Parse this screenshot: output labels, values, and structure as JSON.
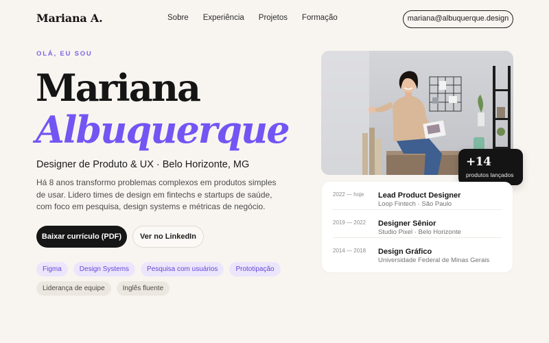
{
  "nav": {
    "logo": "Mariana A.",
    "links": [
      "Sobre",
      "Experiência",
      "Projetos",
      "Formação"
    ],
    "email": "mariana@albuquerque.design"
  },
  "hero": {
    "kicker": "OLÁ, EU SOU",
    "first_name": "Mariana",
    "last_name": "Albuquerque",
    "subtitle": "Designer de Produto & UX · Belo Horizonte, MG",
    "bio": "Há 8 anos transformo problemas complexos em produtos simples de usar. Lidero times de design em fintechs e startups de saúde, com foco em pesquisa, design systems e métricas de negócio.",
    "primary_button": "Baixar currículo (PDF)",
    "secondary_button": "Ver no LinkedIn"
  },
  "skills": {
    "primary": [
      "Figma",
      "Design Systems",
      "Pesquisa com usuários",
      "Prototipação"
    ],
    "secondary": [
      "Liderança de equipe",
      "Inglês fluente"
    ]
  },
  "stat": {
    "value": "+14",
    "label": "produtos lançados"
  },
  "experience": [
    {
      "period": "2022 — hoje",
      "title": "Lead Product Designer",
      "place": "Loop Fintech · São Paulo"
    },
    {
      "period": "2019 — 2022",
      "title": "Designer Sênior",
      "place": "Studio Pixel · Belo Horizonte"
    },
    {
      "period": "2014 — 2018",
      "title": "Design Gráfico",
      "place": "Universidade Federal de Minas Gerais"
    }
  ],
  "colors": {
    "accent": "#7156f3",
    "background": "#f8f5f0",
    "dark": "#161616",
    "tag_purple_bg": "#ebe6fb",
    "tag_gray_bg": "#ece8e1"
  }
}
